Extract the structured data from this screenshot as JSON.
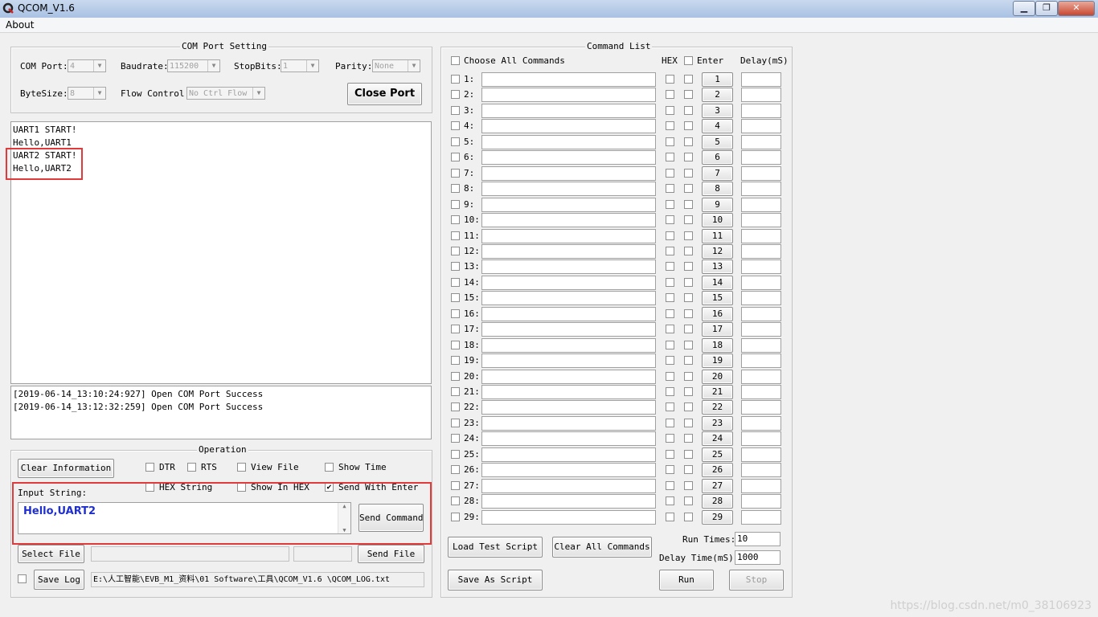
{
  "window": {
    "title": "QCOM_V1.6",
    "icon": "q-logo-icon",
    "minimize": "▁",
    "maximize": "❐",
    "close": "✕"
  },
  "menu": {
    "about": "About"
  },
  "com_port": {
    "group_title": "COM Port Setting",
    "com_port_label": "COM Port:",
    "com_port_value": "4",
    "baudrate_label": "Baudrate:",
    "baudrate_value": "115200",
    "stopbits_label": "StopBits:",
    "stopbits_value": "1",
    "parity_label": "Parity:",
    "parity_value": "None",
    "bytesize_label": "ByteSize:",
    "bytesize_value": "8",
    "flow_label": "Flow Control:",
    "flow_value": "No Ctrl Flow",
    "close_port": "Close Port"
  },
  "receive_log": [
    "UART1 START!",
    "Hello,UART1",
    "UART2 START!",
    "Hello,UART2"
  ],
  "status_log": [
    "[2019-06-14_13:10:24:927] Open COM Port Success",
    "[2019-06-14_13:12:32:259] Open COM Port Success"
  ],
  "operation": {
    "group_title": "Operation",
    "clear_information": "Clear Information",
    "dtr": {
      "label": "DTR",
      "checked": false
    },
    "rts": {
      "label": "RTS",
      "checked": false
    },
    "view_file": {
      "label": "View File",
      "checked": false
    },
    "show_time": {
      "label": "Show Time",
      "checked": false
    },
    "hex_string": {
      "label": "HEX String",
      "checked": false
    },
    "show_in_hex": {
      "label": "Show In HEX",
      "checked": false
    },
    "send_with_enter": {
      "label": "Send With Enter",
      "checked": true
    },
    "input_string_label": "Input String:",
    "input_value": "Hello,UART2",
    "send_command": "Send Command",
    "select_file": "Select File",
    "send_file": "Send File",
    "save_log": "Save Log",
    "save_log_checked": false,
    "log_path": "E:\\人工智能\\EVB_M1_资料\\01 Software\\工具\\QCOM_V1.6 \\QCOM_LOG.txt"
  },
  "command_list": {
    "group_title": "Command List",
    "choose_all": "Choose All Commands",
    "hex_header": "HEX",
    "enter_header": "Enter",
    "delay_header": "Delay(mS)",
    "rows": [
      {
        "label": "1:",
        "button": "1"
      },
      {
        "label": "2:",
        "button": "2"
      },
      {
        "label": "3:",
        "button": "3"
      },
      {
        "label": "4:",
        "button": "4"
      },
      {
        "label": "5:",
        "button": "5"
      },
      {
        "label": "6:",
        "button": "6"
      },
      {
        "label": "7:",
        "button": "7"
      },
      {
        "label": "8:",
        "button": "8"
      },
      {
        "label": "9:",
        "button": "9"
      },
      {
        "label": "10:",
        "button": "10"
      },
      {
        "label": "11:",
        "button": "11"
      },
      {
        "label": "12:",
        "button": "12"
      },
      {
        "label": "13:",
        "button": "13"
      },
      {
        "label": "14:",
        "button": "14"
      },
      {
        "label": "15:",
        "button": "15"
      },
      {
        "label": "16:",
        "button": "16"
      },
      {
        "label": "17:",
        "button": "17"
      },
      {
        "label": "18:",
        "button": "18"
      },
      {
        "label": "19:",
        "button": "19"
      },
      {
        "label": "20:",
        "button": "20"
      },
      {
        "label": "21:",
        "button": "21"
      },
      {
        "label": "22:",
        "button": "22"
      },
      {
        "label": "23:",
        "button": "23"
      },
      {
        "label": "24:",
        "button": "24"
      },
      {
        "label": "25:",
        "button": "25"
      },
      {
        "label": "26:",
        "button": "26"
      },
      {
        "label": "27:",
        "button": "27"
      },
      {
        "label": "28:",
        "button": "28"
      },
      {
        "label": "29:",
        "button": "29"
      }
    ],
    "load_test_script": "Load Test Script",
    "clear_all_commands": "Clear All Commands",
    "save_as_script": "Save As Script",
    "run_times_label": "Run Times:",
    "run_times_value": "10",
    "delay_time_label": "Delay Time(mS):",
    "delay_time_value": "1000",
    "run": "Run",
    "stop": "Stop"
  },
  "watermark": "https://blog.csdn.net/m0_38106923",
  "colors": {
    "highlight_box": "#e03a3a",
    "input_text": "#1f2fcf"
  }
}
